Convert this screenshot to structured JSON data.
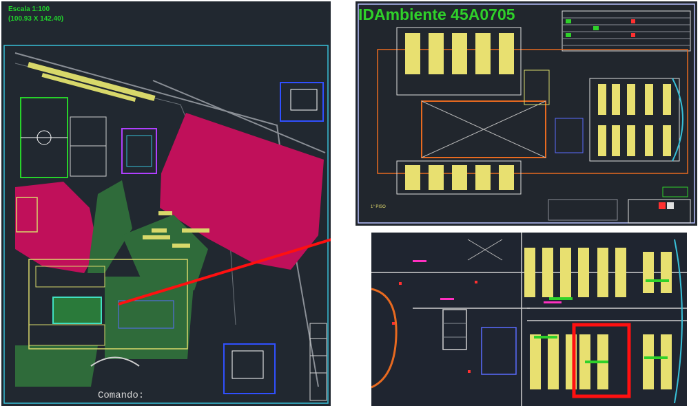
{
  "site_plan": {
    "scale_label": "Escala 1:100",
    "dims_label": "(100.93 X 142.40)",
    "command_prompt": "Comando:"
  },
  "floor_plan": {
    "title": "IDAmbiente 45A0705",
    "floor_label": "1° PISO"
  },
  "detail_view": {},
  "colors": {
    "cad_background": "#212830",
    "label_green": "#21d22c",
    "title_green": "#2fd12a",
    "highlight_red": "#ff1010",
    "hatch_magenta": "#c0105a",
    "plan_cyan": "#38c0d8",
    "desk_yellow": "#e8e070"
  }
}
